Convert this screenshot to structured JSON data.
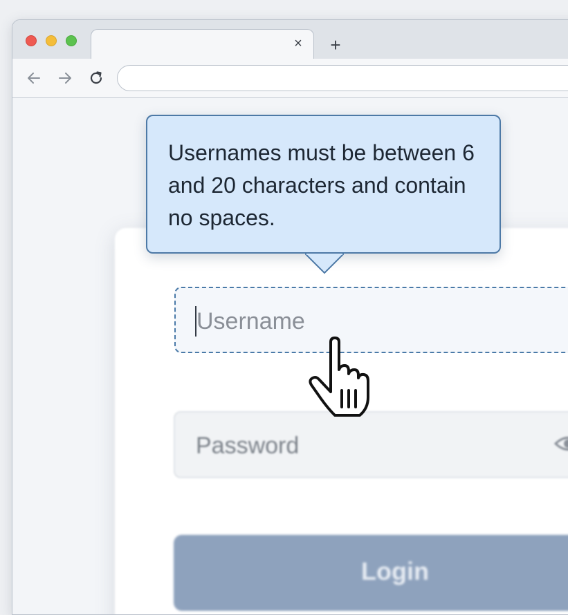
{
  "browser": {
    "tab_close_symbol": "×",
    "new_tab_symbol": "+"
  },
  "tooltip": {
    "text": "Usernames must be between 6 and 20 characters and contain no spaces."
  },
  "login_form": {
    "username_placeholder": "Username",
    "password_placeholder": "Password",
    "login_label": "Login"
  },
  "colors": {
    "tooltip_background": "#d6e8fb",
    "tooltip_border": "#4d79a6",
    "login_button": "#8ea2bd"
  },
  "icons": {
    "back": "arrow-left-icon",
    "forward": "arrow-right-icon",
    "reload": "reload-icon",
    "close": "close-icon",
    "new_tab": "plus-icon",
    "password_visibility": "eye-icon",
    "cursor": "hand-pointer-icon"
  }
}
